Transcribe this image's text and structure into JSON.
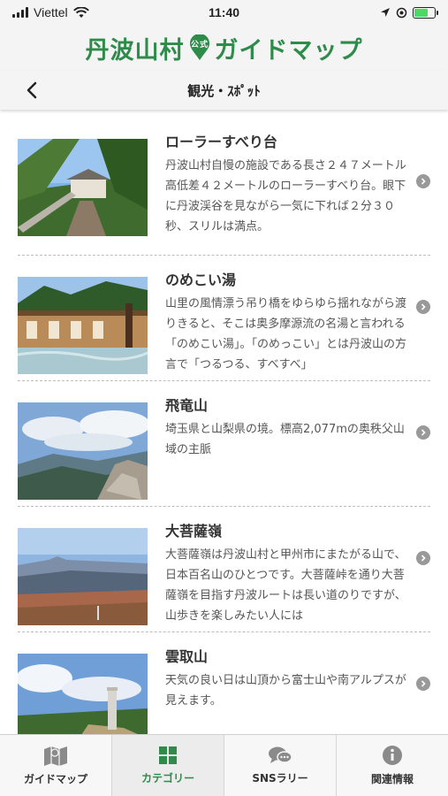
{
  "status_bar": {
    "carrier": "Viettel",
    "time": "11:40",
    "battery_level": 0.7,
    "icons": [
      "signal-icon",
      "wifi-icon",
      "location-icon",
      "alarm-icon",
      "battery-icon"
    ]
  },
  "brand": {
    "title_left": "丹波山村",
    "badge": "公式",
    "title_right": "ガイドマップ",
    "color": "#2e8b4a"
  },
  "nav": {
    "title": "観光・ｽﾎﾟｯﾄ",
    "back_icon": "chevron-left-icon"
  },
  "spots": [
    {
      "title": "ローラーすべり台",
      "description": "丹波山村自慢の施設である長さ２４７メートル高低差４２メートルのローラーすべり台。眼下に丹波渓谷を見ながら一気に下れば２分３０秒、スリルは満点。",
      "image": "roller-slide-photo"
    },
    {
      "title": "のめこい湯",
      "description": "山里の風情漂う吊り橋をゆらゆら揺れながら渡りきると、そこは奥多摩源流の名湯と言われる「のめこい湯」。「のめっこい」とは丹波山の方言で「つるつる、すべすべ」",
      "image": "hot-spring-photo"
    },
    {
      "title": "飛竜山",
      "description": "埼玉県と山梨県の境。標高2,077mの奥秩父山域の主脈",
      "image": "mountain-ridge-photo"
    },
    {
      "title": "大菩薩嶺",
      "description": "大菩薩嶺は丹波山村と甲州市にまたがる山で、日本百名山のひとつです。大菩薩峠を通り大菩薩嶺を目指す丹波ルートは長い道のりですが、山歩きを楽しみたい人には",
      "image": "daibosatsu-photo"
    },
    {
      "title": "雲取山",
      "description": "天気の良い日は山頂から富士山や南アルプスが見えます。",
      "image": "kumotori-photo"
    }
  ],
  "tabs": [
    {
      "label": "ガイドマップ",
      "icon": "map-icon",
      "active": false
    },
    {
      "label": "カテゴリー",
      "icon": "grid-icon",
      "active": true
    },
    {
      "label": "SNSラリー",
      "icon": "chat-bubbles-icon",
      "active": false
    },
    {
      "label": "関連情報",
      "icon": "info-icon",
      "active": false
    }
  ],
  "colors": {
    "accent": "#2e8b4a",
    "chevron": "#999999",
    "divider": "#bdbdbd"
  }
}
